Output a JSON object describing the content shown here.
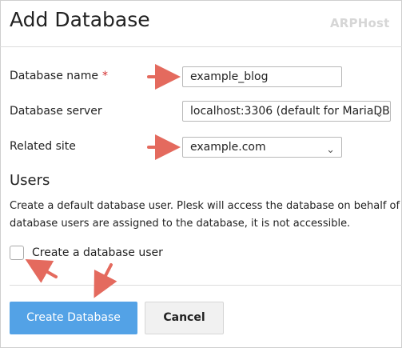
{
  "header": {
    "title": "Add Database",
    "logo_text": "ARPHost"
  },
  "form": {
    "database_name": {
      "label": "Database name",
      "required_marker": "*",
      "value": "example_blog"
    },
    "database_server": {
      "label": "Database server",
      "value": "localhost:3306 (default for MariaDB"
    },
    "related_site": {
      "label": "Related site",
      "value": "example.com"
    }
  },
  "users": {
    "heading": "Users",
    "description_line1": "Create a default database user. Plesk will access the database on behalf of",
    "description_line2": "database users are assigned to the database, it is not accessible.",
    "checkbox_label": "Create a database user",
    "checkbox_checked": false
  },
  "actions": {
    "primary_label": "Create Database",
    "secondary_label": "Cancel"
  },
  "colors": {
    "primary": "#53a2e6",
    "required": "#d32f2f",
    "annotation_arrow": "#e46a5e"
  },
  "icons": {
    "select_chevron": "chevron-down-icon",
    "annotation": "arrow-icon"
  }
}
